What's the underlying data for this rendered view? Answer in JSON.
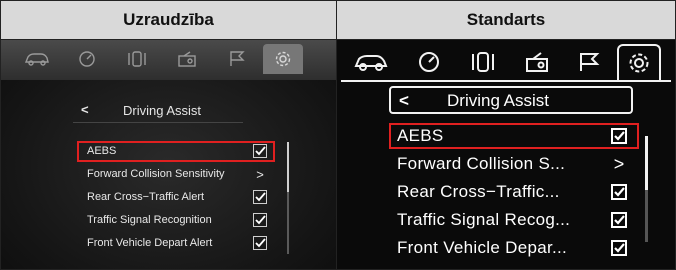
{
  "headers": {
    "left": "Uzraudzība",
    "right": "Standarts"
  },
  "colors": {
    "highlight": "#e02020",
    "left_tab_bg": "#4a4a4a",
    "right_bg": "#0a0a0a"
  },
  "tabs": [
    {
      "icon": "car-icon"
    },
    {
      "icon": "gauge-icon"
    },
    {
      "icon": "vehicle-status-icon"
    },
    {
      "icon": "radio-icon"
    },
    {
      "icon": "flag-icon"
    },
    {
      "icon": "gear-icon",
      "active": true
    }
  ],
  "left": {
    "title": "Driving Assist",
    "back": "<",
    "items": [
      {
        "label": "AEBS",
        "control": "checkbox",
        "checked": true,
        "selected": true
      },
      {
        "label": "Forward Collision Sensitivity",
        "control": "arrow",
        "arrow": ">"
      },
      {
        "label": "Rear Cross−Traffic Alert",
        "control": "checkbox",
        "checked": true
      },
      {
        "label": "Traffic Signal Recognition",
        "control": "checkbox",
        "checked": true
      },
      {
        "label": "Front Vehicle Depart Alert",
        "control": "checkbox",
        "checked": true
      }
    ]
  },
  "right": {
    "title": "Driving Assist",
    "back": "<",
    "items": [
      {
        "label": "AEBS",
        "control": "checkbox",
        "checked": true,
        "selected": true
      },
      {
        "label": "Forward Collision S...",
        "control": "arrow",
        "arrow": ">"
      },
      {
        "label": "Rear Cross−Traffic...",
        "control": "checkbox",
        "checked": true
      },
      {
        "label": "Traffic Signal Recog...",
        "control": "checkbox",
        "checked": true
      },
      {
        "label": "Front Vehicle Depar...",
        "control": "checkbox",
        "checked": true
      }
    ]
  }
}
